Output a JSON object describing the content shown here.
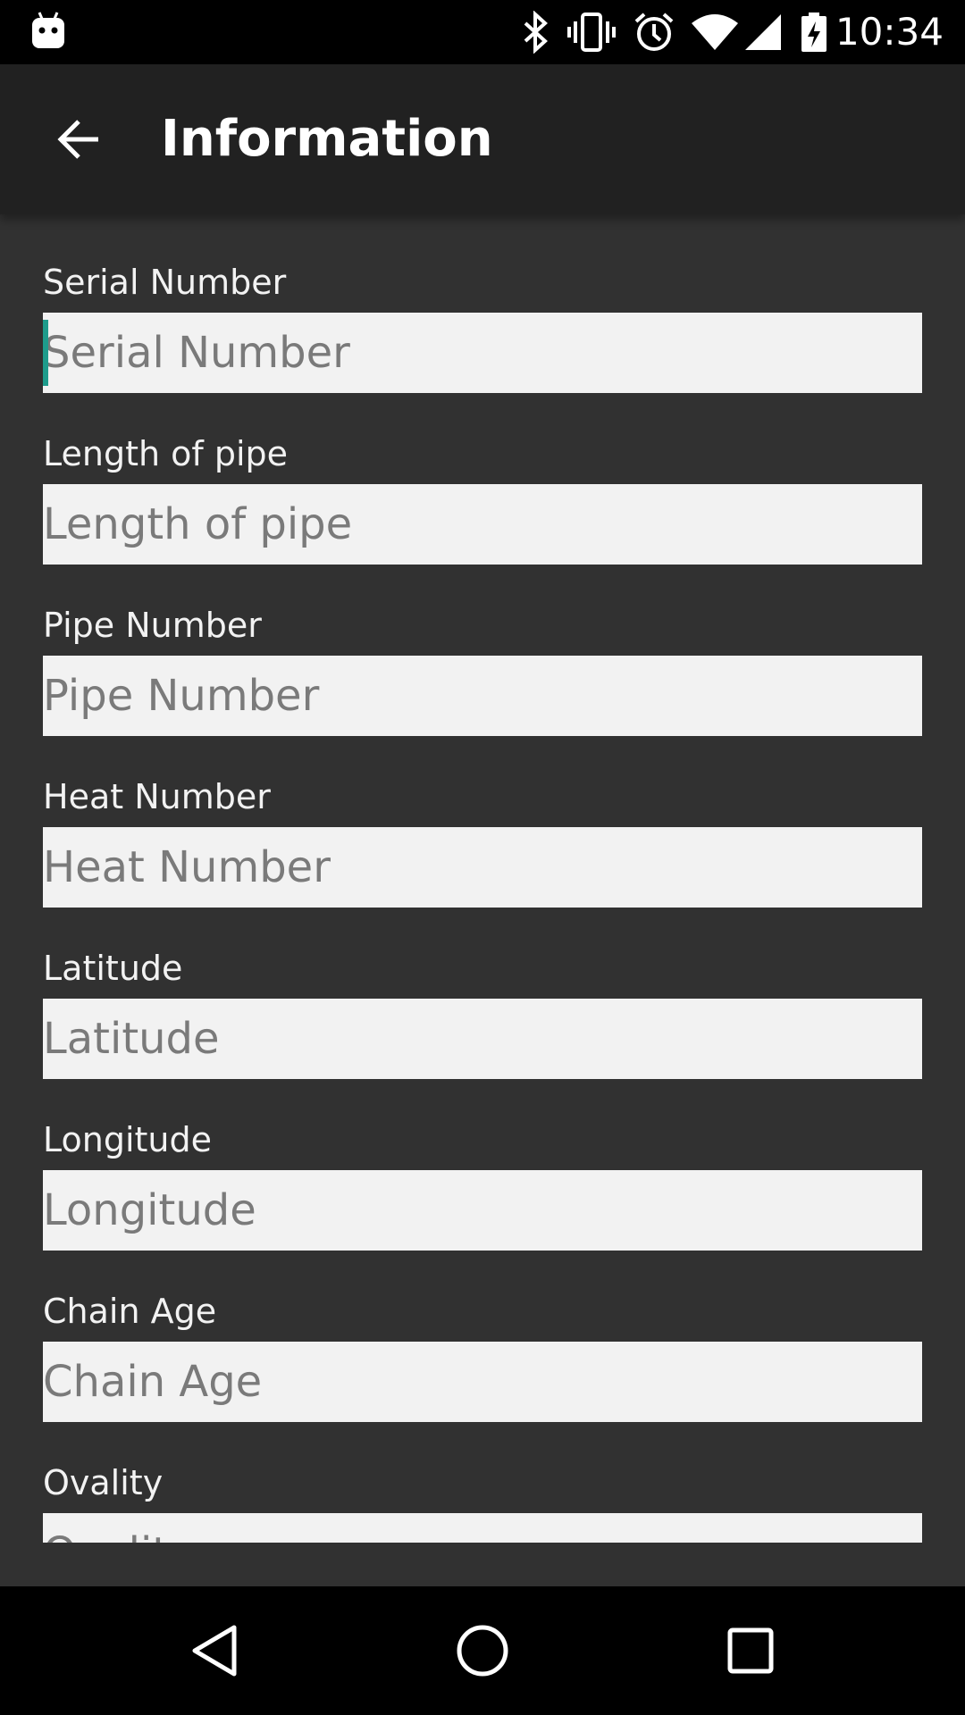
{
  "status_bar": {
    "time": "10:34",
    "icons": [
      "android-notification-icon",
      "bluetooth-icon",
      "vibrate-icon",
      "alarm-icon",
      "wifi-icon",
      "cell-signal-icon",
      "battery-charging-icon"
    ]
  },
  "app_bar": {
    "title": "Information",
    "back_icon": "arrow-back-icon"
  },
  "form": {
    "fields": [
      {
        "label": "Serial Number",
        "placeholder": "Serial Number",
        "value": ""
      },
      {
        "label": "Length of pipe",
        "placeholder": "Length of pipe",
        "value": ""
      },
      {
        "label": "Pipe Number",
        "placeholder": "Pipe Number",
        "value": ""
      },
      {
        "label": "Heat Number",
        "placeholder": "Heat Number",
        "value": ""
      },
      {
        "label": "Latitude",
        "placeholder": "Latitude",
        "value": ""
      },
      {
        "label": "Longitude",
        "placeholder": "Longitude",
        "value": ""
      },
      {
        "label": "Chain Age",
        "placeholder": "Chain Age",
        "value": ""
      },
      {
        "label": "Ovality",
        "placeholder": "Ovality",
        "value": ""
      }
    ],
    "focused_field": "Serial Number"
  },
  "colors": {
    "background": "#313131",
    "app_bar": "#212121",
    "input_bg": "#f2f2f2",
    "cursor": "#1e9c8c"
  },
  "nav_bar": {
    "icons": [
      "back-triangle-icon",
      "home-circle-icon",
      "recents-square-icon"
    ]
  }
}
